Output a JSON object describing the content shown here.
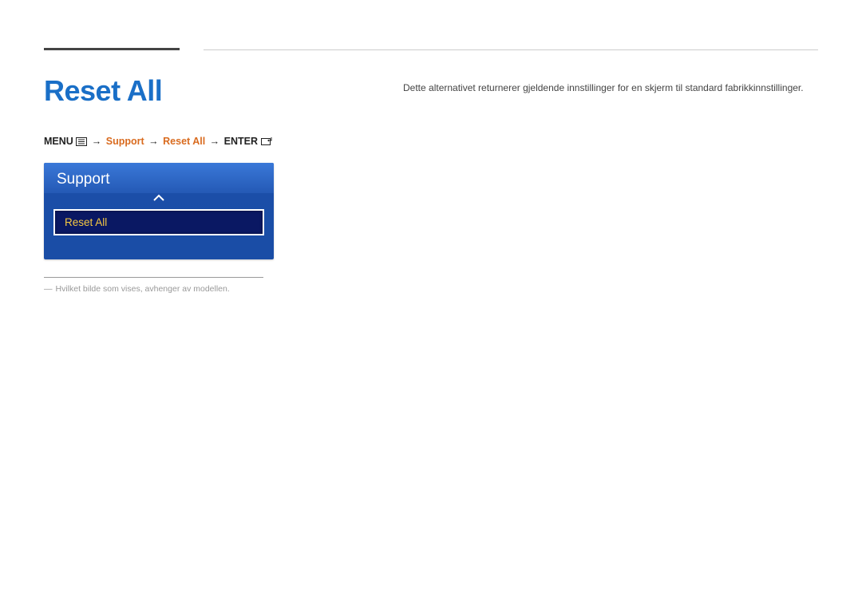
{
  "section": {
    "title": "Reset All"
  },
  "breadcrumb": {
    "menu_label": "MENU",
    "arrow": "→",
    "support": "Support",
    "reset_all": "Reset All",
    "enter_label": "ENTER"
  },
  "osd": {
    "header": "Support",
    "item": "Reset All"
  },
  "footnote": {
    "dash": "―",
    "text": "Hvilket bilde som vises, avhenger av modellen."
  },
  "description": {
    "text": "Dette alternativet returnerer gjeldende innstillinger for en skjerm til standard fabrikkinnstillinger."
  }
}
